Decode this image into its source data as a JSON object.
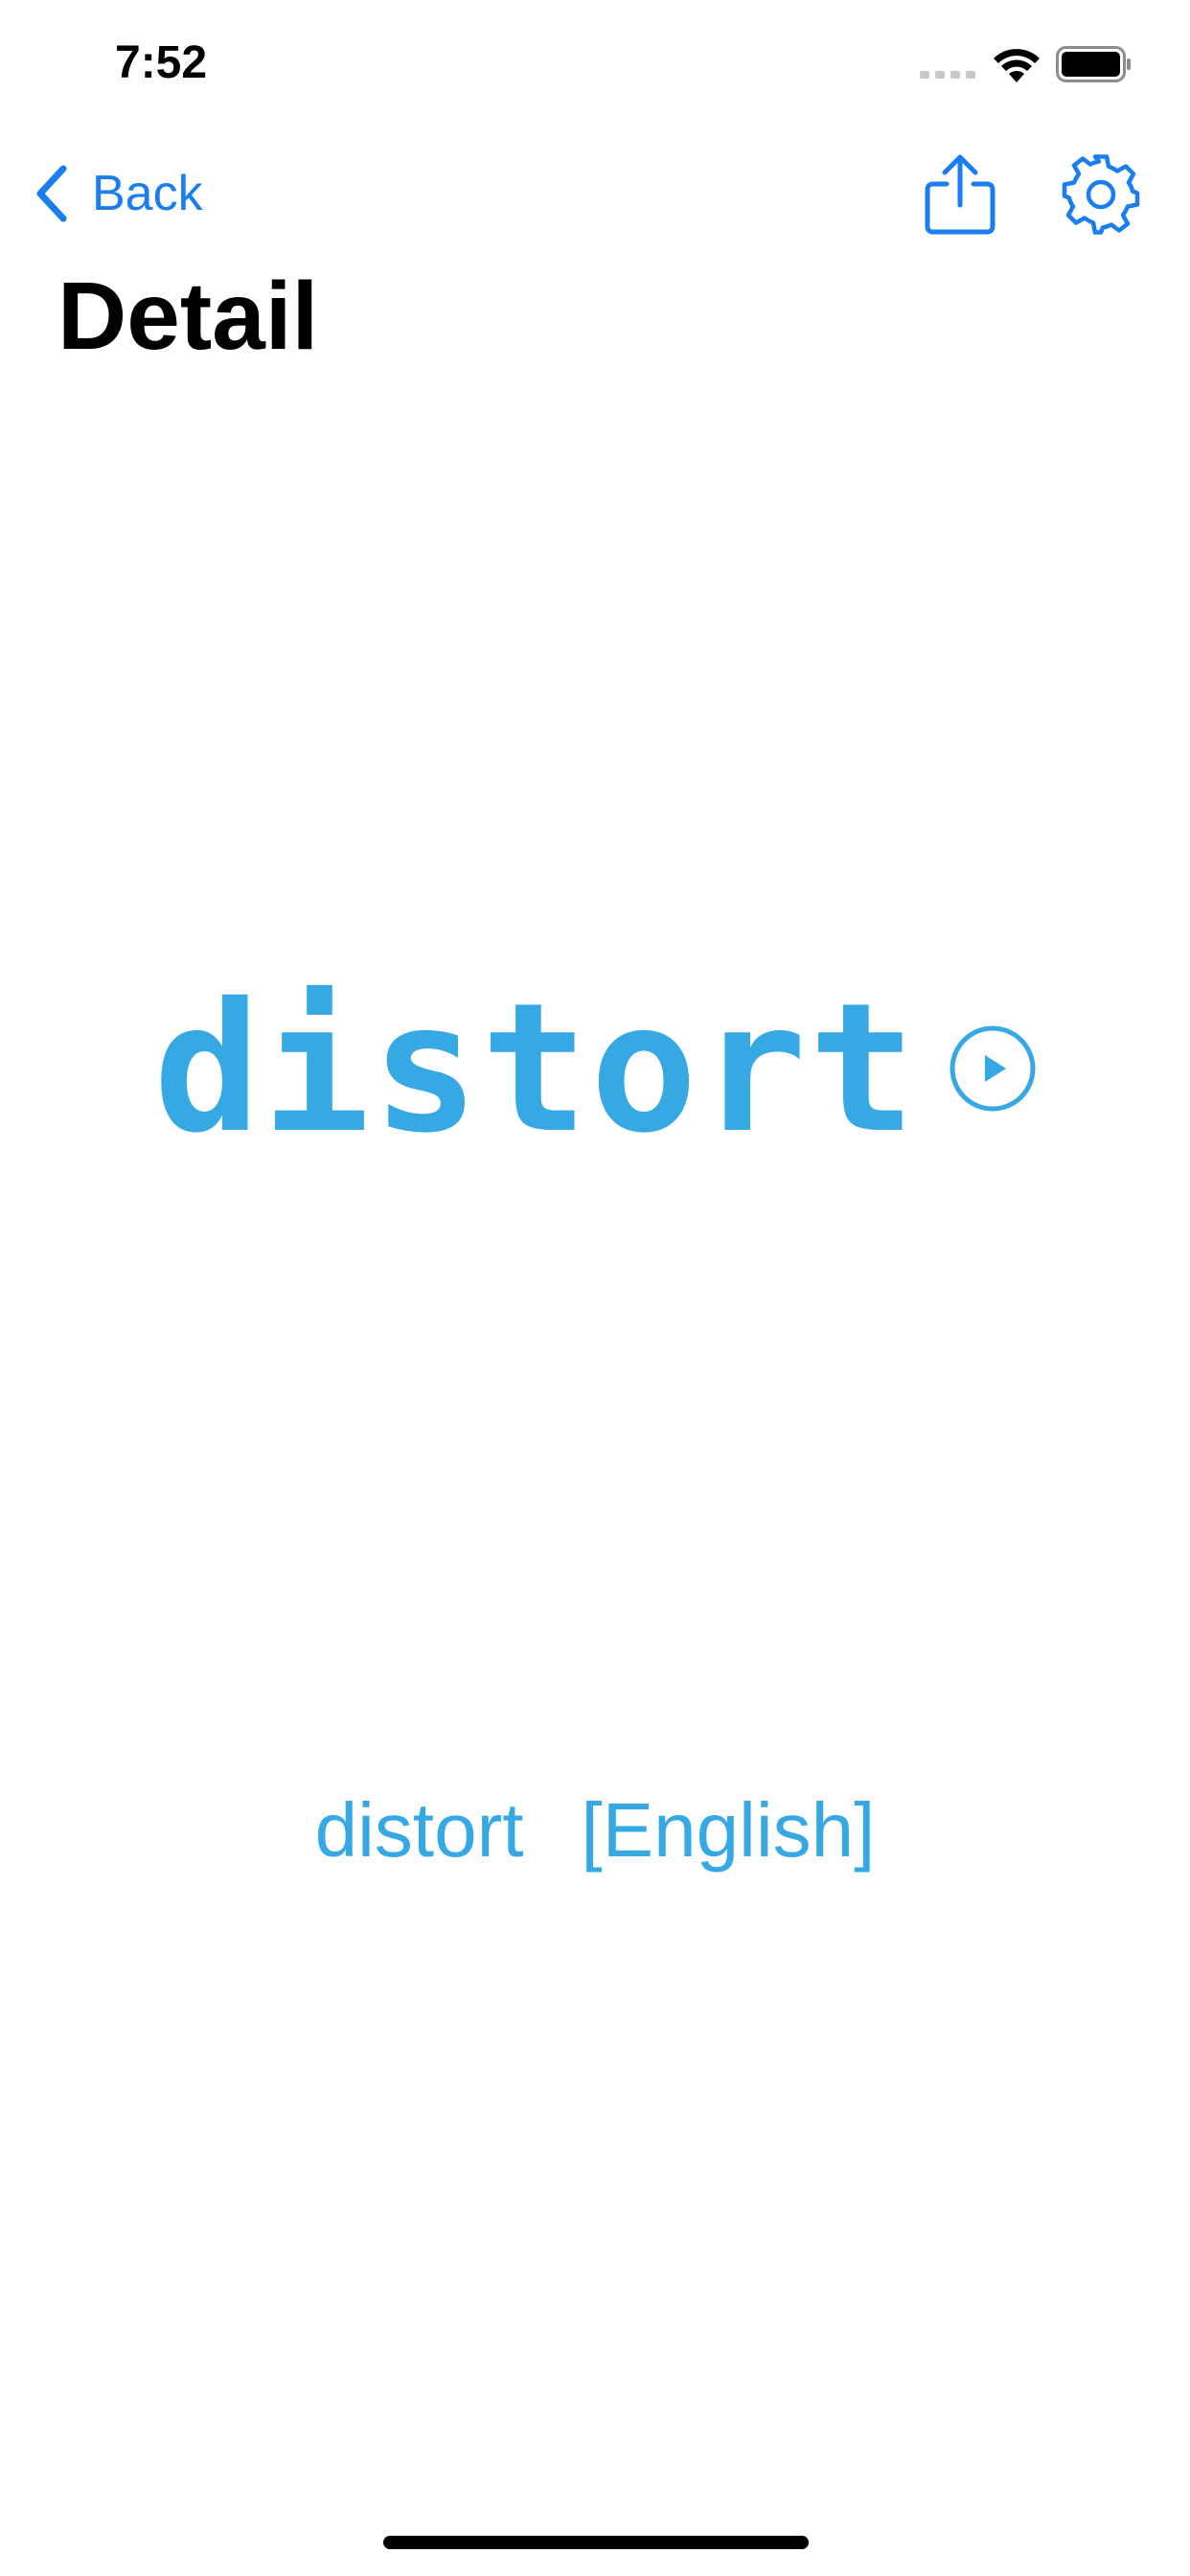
{
  "status_bar": {
    "time": "7:52"
  },
  "nav": {
    "back_label": "Back",
    "share_icon": "share-icon",
    "settings_icon": "gear-icon",
    "accent_color": "#1a7ef0"
  },
  "page": {
    "title": "Detail"
  },
  "word": {
    "text": "distort",
    "play_icon": "play-circle-icon",
    "color": "#36a9e4"
  },
  "translation": {
    "word": "distort",
    "language": "[English]"
  }
}
